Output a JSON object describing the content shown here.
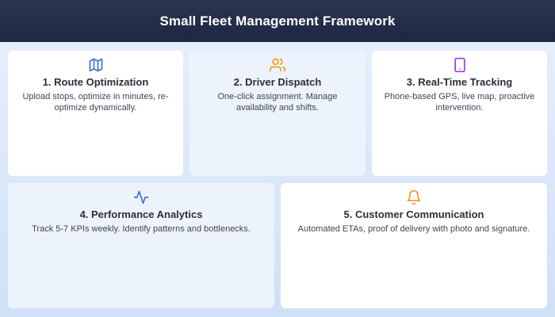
{
  "title": "Small Fleet Management Framework",
  "cards": [
    {
      "heading": "1. Route Optimization",
      "text": "Upload stops, optimize in minutes, re-optimize dynamically.",
      "icon": "map-icon",
      "icon_color": "#3b6fd8"
    },
    {
      "heading": "2. Driver Dispatch",
      "text": "One-click assignment. Manage availability and shifts.",
      "icon": "users-icon",
      "icon_color": "#f29a1e"
    },
    {
      "heading": "3. Real-Time Tracking",
      "text": "Phone-based GPS, live map, proactive intervention.",
      "icon": "smartphone-icon",
      "icon_color": "#9b3fd6"
    },
    {
      "heading": "4. Performance Analytics",
      "text": "Track 5-7 KPIs weekly. Identify patterns and bottlenecks.",
      "icon": "activity-icon",
      "icon_color": "#3b6fd8"
    },
    {
      "heading": "5. Customer Communication",
      "text": "Automated ETAs, proof of delivery with photo and signature.",
      "icon": "bell-icon",
      "icon_color": "#f29a1e"
    }
  ]
}
